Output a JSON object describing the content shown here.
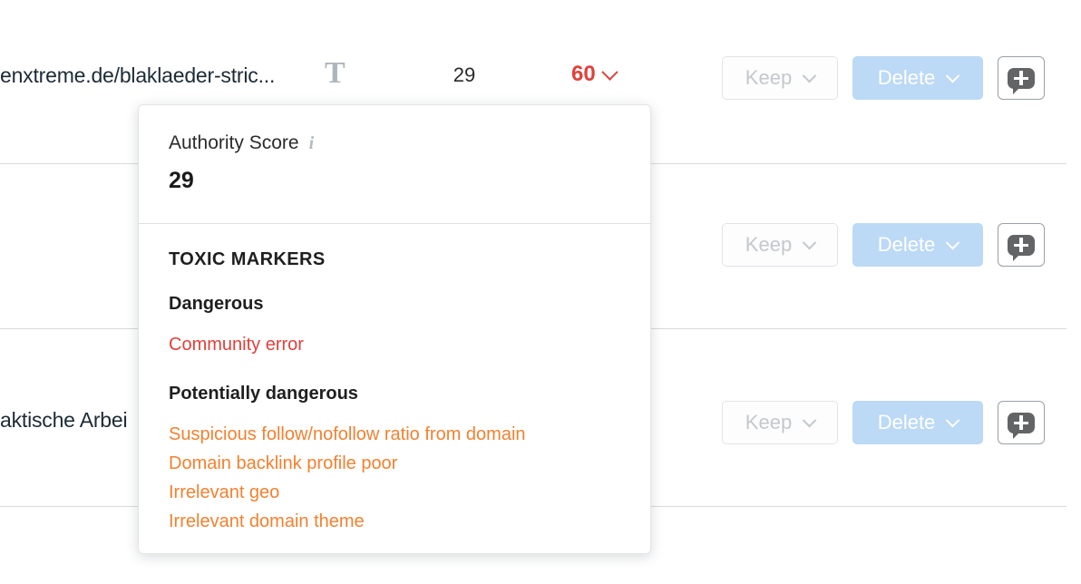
{
  "table": {
    "rows": [
      {
        "url": "enxtreme.de/blaklaeder-stric...",
        "type_icon": "T",
        "authority_score": "29",
        "toxicity_score": "60",
        "toxicity_level": "high",
        "keep_label": "Keep",
        "delete_label": "Delete",
        "note_icon": "comment-plus-icon"
      },
      {
        "url": "",
        "type_icon": "",
        "authority_score": "",
        "toxicity_score": "",
        "toxicity_level": "high",
        "keep_label": "Keep",
        "delete_label": "Delete",
        "note_icon": "comment-plus-icon"
      },
      {
        "url": "aktische Arbei",
        "type_icon": "",
        "authority_score": "",
        "toxicity_score": "",
        "toxicity_level": "medium",
        "keep_label": "Keep",
        "delete_label": "Delete",
        "note_icon": "comment-plus-icon"
      }
    ]
  },
  "tooltip": {
    "authority_label": "Authority Score",
    "info_icon": "i",
    "authority_value": "29",
    "toxic_markers_title": "TOXIC MARKERS",
    "groups": [
      {
        "title": "Dangerous",
        "severity": "danger",
        "items": [
          "Community error"
        ]
      },
      {
        "title": "Potentially dangerous",
        "severity": "warn",
        "items": [
          "Suspicious follow/nofollow ratio from domain",
          "Domain backlink profile poor",
          "Irrelevant geo",
          "Irrelevant domain theme"
        ]
      }
    ]
  },
  "colors": {
    "danger": "#e0403a",
    "warn": "#f28130",
    "delete_button": "#bcd9f5",
    "keep_text": "#c3c8cd",
    "type_icon": "#aeb6bd"
  }
}
